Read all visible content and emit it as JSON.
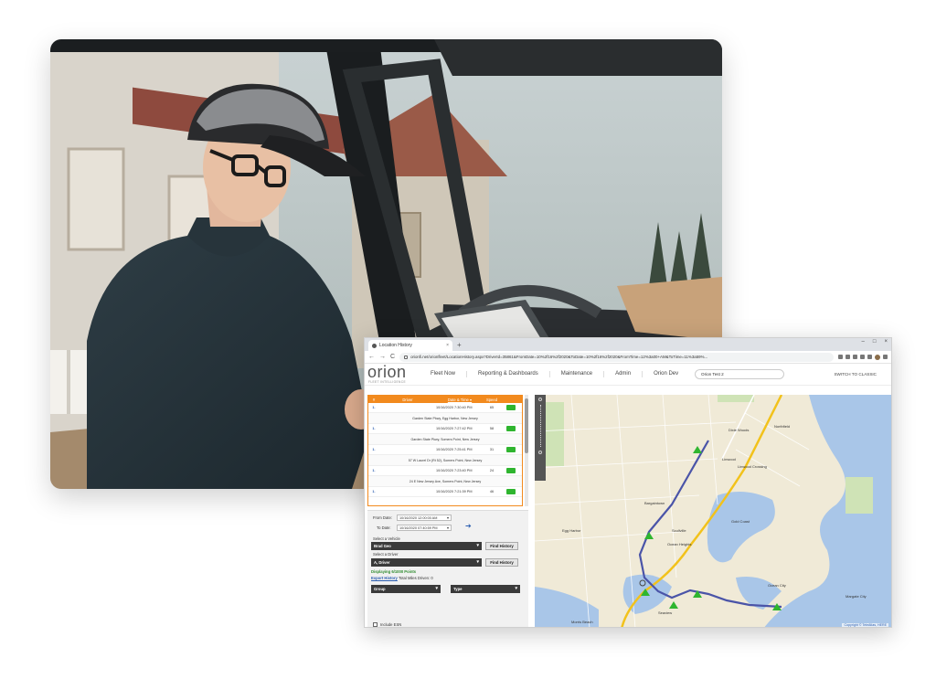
{
  "browser": {
    "tab_title": "Location History",
    "tab_close": "×",
    "new_tab": "+",
    "window_controls": [
      "–",
      "□",
      "×"
    ],
    "nav": [
      "←",
      "→",
      "C"
    ],
    "url": "orionfi.net/orionfleet/LocationHistory.aspx?DriverId=35861&FromDate=10%2f16%2f2020&ToDate=10%2f16%2f2020&FromTime=12%3a00+AM&ToTime=11%3a59%..."
  },
  "app": {
    "logo_text": "orion",
    "logo_tagline": "FLEET INTELLIGENCE",
    "menu": [
      "Fleet Now",
      "Reporting & Dashboards",
      "Maintenance",
      "Admin",
      "Orion Dev"
    ],
    "account": "Orion Test 2",
    "switch_label": "SWITCH TO CLASSIC"
  },
  "history_table": {
    "headers": [
      "#",
      "Driver",
      "Date & Time ▾",
      "Speed"
    ],
    "rows": [
      {
        "num": "1.",
        "datetime": "10/16/2020 7:30:40 PM",
        "speed": "65",
        "address": "Garden State Pkwy, Egg Harbor, New Jersey"
      },
      {
        "num": "1.",
        "datetime": "10/16/2020 7:27:42 PM",
        "speed": "58",
        "address": "Garden State Pkwy, Somers Point, New Jersey"
      },
      {
        "num": "1.",
        "datetime": "10/16/2020 7:25:41 PM",
        "speed": "31",
        "address": "57 W Laurel Dr (Rt 52), Somers Point, New Jersey"
      },
      {
        "num": "1.",
        "datetime": "10/16/2020 7:23:40 PM",
        "speed": "24",
        "address": "24 E New Jersey Ave, Somers Point, New Jersey"
      },
      {
        "num": "1.",
        "datetime": "10/16/2020 7:21:39 PM",
        "speed": "46",
        "address": ""
      }
    ]
  },
  "filters": {
    "from_label": "From Date:",
    "from_value": "10/16/2020 12:00:00 AM",
    "to_label": "To Date:",
    "to_value": "10/16/2020 07:40:59 PM",
    "go_arrow": "➔",
    "vehicle_label": "Select a Vehicle",
    "vehicle_value": "Brad Geo",
    "driver_label": "Select a Driver",
    "driver_value": "A, Driver",
    "find_label": "Find History",
    "displaying": "Displaying 6/1000 Points",
    "export_label": "Export History",
    "miles_label": "Total Miles Driven: 0",
    "group_label": "Group",
    "type_label": "Type",
    "include_esn": "Include ESN"
  },
  "map": {
    "labels": [
      "Northfield",
      "Linwood",
      "Linwood Crossing",
      "Ocean Heights",
      "Scullville",
      "Gold Coast",
      "Ocean City",
      "Margate City",
      "Morris Beach",
      "Seaview",
      "Egg Harbor",
      "Bargaintown",
      "Dixie Woods"
    ],
    "copyright": "Copyright © TeleAtlas, HERE",
    "colors": {
      "route": "#4a54a8",
      "highway": "#f2c21b",
      "water": "#a9c6e8",
      "land": "#f0ead7",
      "marker": "#2fb52f"
    }
  }
}
